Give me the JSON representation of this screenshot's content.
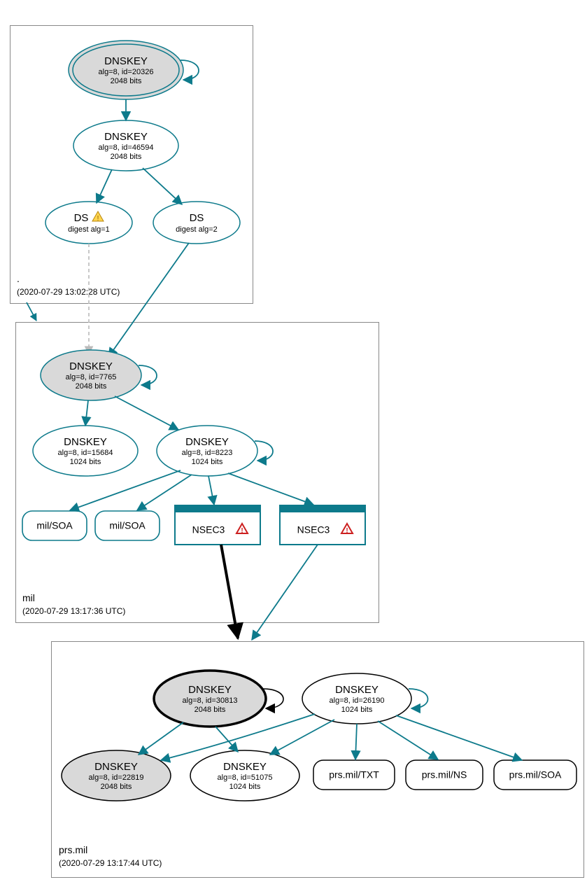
{
  "colors": {
    "teal": "#0d7a8b",
    "fillGray": "#d9d9d9",
    "boxBorder": "#888888"
  },
  "zones": {
    "root": {
      "name": ".",
      "timestamp": "(2020-07-29 13:02:28 UTC)",
      "nodes": {
        "ksk": {
          "t1": "DNSKEY",
          "t2": "alg=8, id=20326",
          "t3": "2048 bits"
        },
        "zsk": {
          "t1": "DNSKEY",
          "t2": "alg=8, id=46594",
          "t3": "2048 bits"
        },
        "ds1": {
          "t1": "DS",
          "t2": "digest alg=1"
        },
        "ds2": {
          "t1": "DS",
          "t2": "digest alg=2"
        }
      }
    },
    "mil": {
      "name": "mil",
      "timestamp": "(2020-07-29 13:17:36 UTC)",
      "nodes": {
        "ksk": {
          "t1": "DNSKEY",
          "t2": "alg=8, id=7765",
          "t3": "2048 bits"
        },
        "zsk1": {
          "t1": "DNSKEY",
          "t2": "alg=8, id=15684",
          "t3": "1024 bits"
        },
        "zsk2": {
          "t1": "DNSKEY",
          "t2": "alg=8, id=8223",
          "t3": "1024 bits"
        },
        "soa1": {
          "t1": "mil/SOA"
        },
        "soa2": {
          "t1": "mil/SOA"
        },
        "nsec1": {
          "t1": "NSEC3"
        },
        "nsec2": {
          "t1": "NSEC3"
        }
      }
    },
    "prs": {
      "name": "prs.mil",
      "timestamp": "(2020-07-29 13:17:44 UTC)",
      "nodes": {
        "ksk": {
          "t1": "DNSKEY",
          "t2": "alg=8, id=30813",
          "t3": "2048 bits"
        },
        "zsk": {
          "t1": "DNSKEY",
          "t2": "alg=8, id=26190",
          "t3": "1024 bits"
        },
        "dk3": {
          "t1": "DNSKEY",
          "t2": "alg=8, id=22819",
          "t3": "2048 bits"
        },
        "dk4": {
          "t1": "DNSKEY",
          "t2": "alg=8, id=51075",
          "t3": "1024 bits"
        },
        "txt": {
          "t1": "prs.mil/TXT"
        },
        "ns": {
          "t1": "prs.mil/NS"
        },
        "soa": {
          "t1": "prs.mil/SOA"
        }
      }
    }
  }
}
